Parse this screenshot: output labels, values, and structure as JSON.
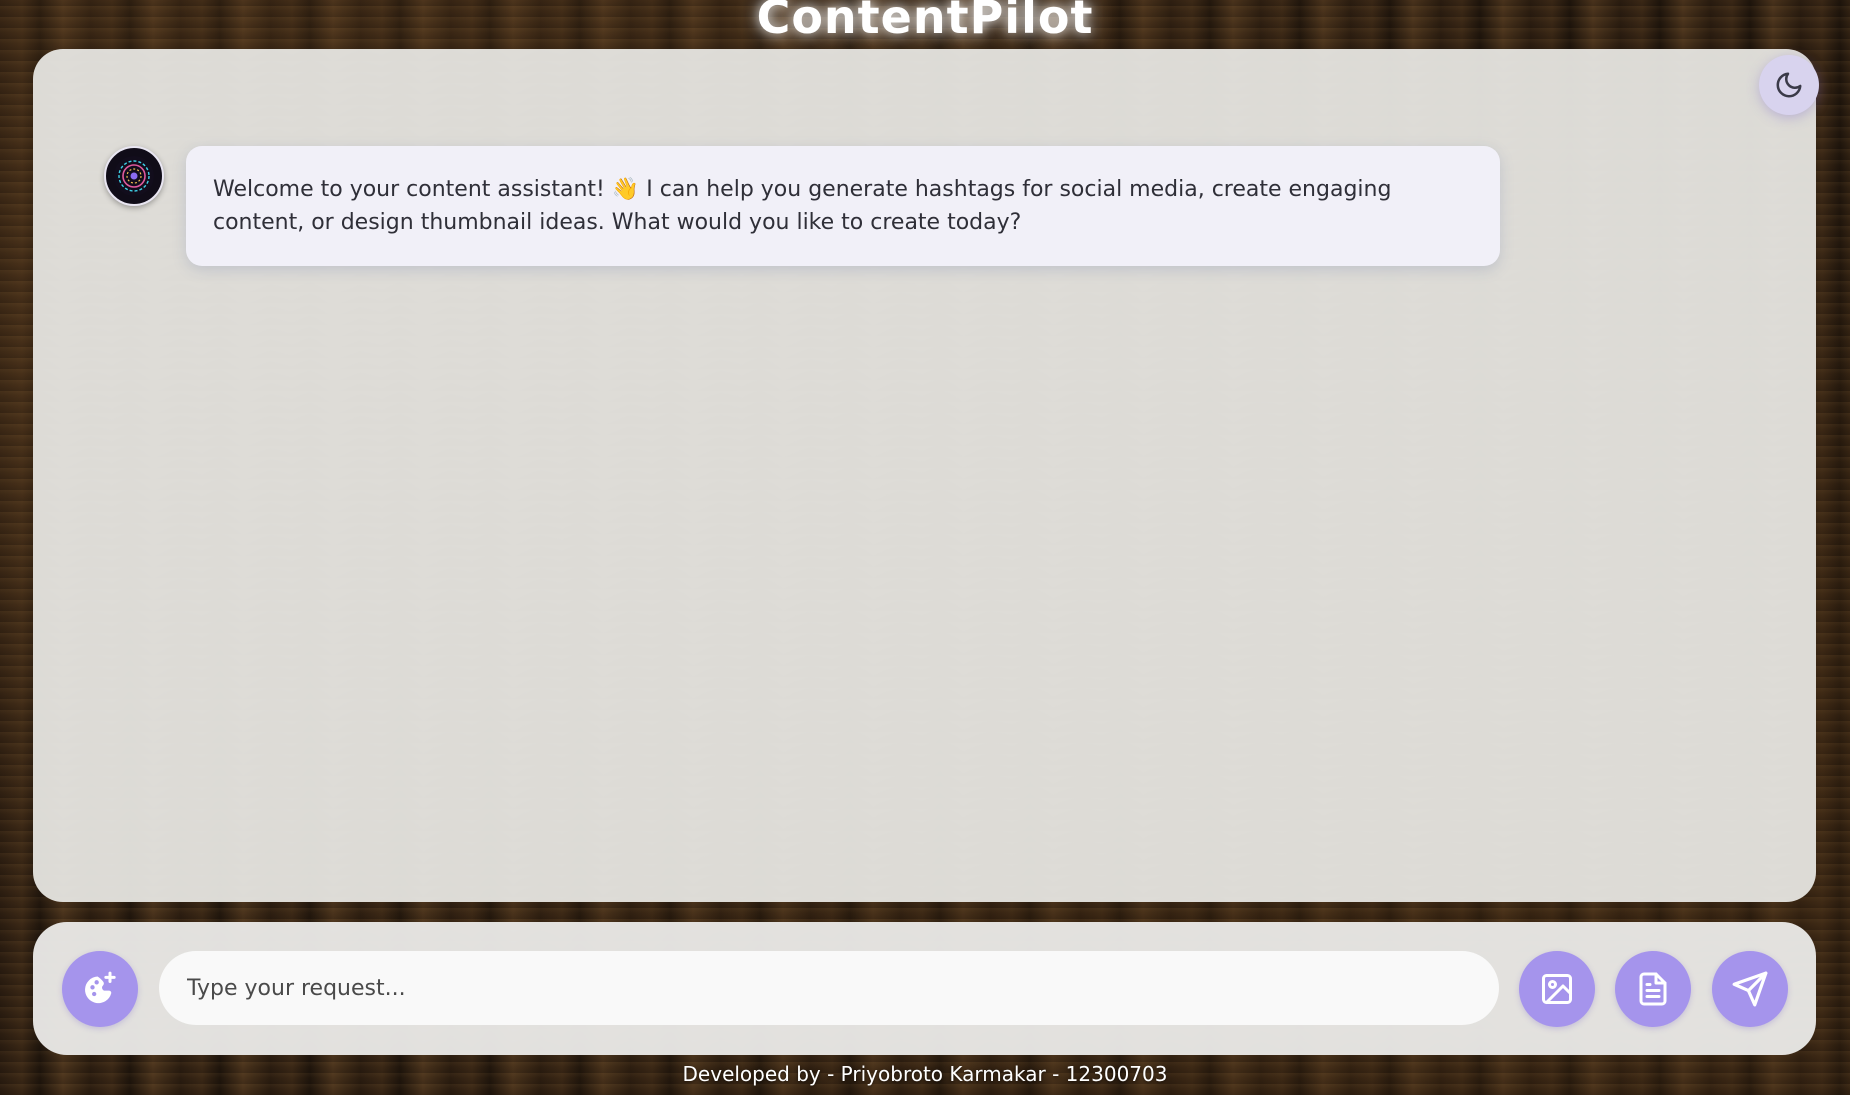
{
  "header": {
    "title": "ContentPilot"
  },
  "theme_toggle": {
    "icon": "moon-icon"
  },
  "chat": {
    "messages": [
      {
        "sender_avatar": "bot-avatar",
        "text": "Welcome to your content assistant! 👋 I can help you generate hashtags for social media, create engaging content, or design thumbnail ideas. What would you like to create today?"
      }
    ]
  },
  "composer": {
    "placeholder": "Type your request...",
    "value": "",
    "left_button_icon": "palette-sparkle-icon",
    "image_button_icon": "image-icon",
    "document_button_icon": "document-icon",
    "send_button_icon": "send-icon"
  },
  "footer": {
    "text": "Developed by - Priyobroto Karmakar - 12300703"
  },
  "colors": {
    "accent": "#a594ec",
    "bubble": "#f1f0f8",
    "panel": "#e4e3df"
  }
}
